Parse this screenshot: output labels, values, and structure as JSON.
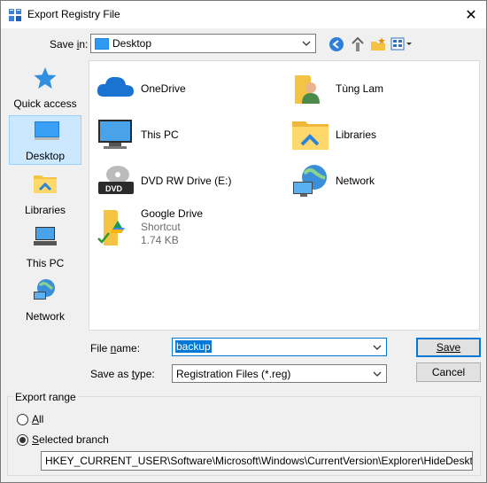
{
  "window": {
    "title": "Export Registry File",
    "close_glyph": "✕"
  },
  "save_in": {
    "label": "Save in:",
    "value": "Desktop"
  },
  "places": [
    {
      "label": "Quick access",
      "icon": "star-icon"
    },
    {
      "label": "Desktop",
      "icon": "desktop-icon",
      "selected": true
    },
    {
      "label": "Libraries",
      "icon": "libraries-folder-icon"
    },
    {
      "label": "This PC",
      "icon": "computer-icon"
    },
    {
      "label": "Network",
      "icon": "network-globe-icon"
    }
  ],
  "items": [
    {
      "name": "OneDrive",
      "icon": "cloud-icon"
    },
    {
      "name": "Tùng Lam",
      "icon": "user-folder-icon"
    },
    {
      "name": "This PC",
      "icon": "computer-icon"
    },
    {
      "name": "Libraries",
      "icon": "libraries-folder-icon"
    },
    {
      "name": "DVD RW Drive (E:)",
      "icon": "dvd-drive-icon"
    },
    {
      "name": "Network",
      "icon": "network-globe-icon"
    },
    {
      "name": "Google Drive",
      "sub1": "Shortcut",
      "sub2": "1.74 KB",
      "icon": "google-drive-folder-icon"
    }
  ],
  "file_name": {
    "label": "File name:",
    "value": "backup"
  },
  "save_as_type": {
    "label": "Save as type:",
    "value": "Registration Files (*.reg)"
  },
  "buttons": {
    "save": "Save",
    "cancel": "Cancel"
  },
  "export_range": {
    "label": "Export range",
    "all": "All",
    "selected_branch": "Selected branch",
    "selected": "selected_branch",
    "branch_path": "HKEY_CURRENT_USER\\Software\\Microsoft\\Windows\\CurrentVersion\\Explorer\\HideDesktopIcons\\Ne"
  },
  "colors": {
    "accent": "#0078d7",
    "selection": "#cce8ff"
  }
}
